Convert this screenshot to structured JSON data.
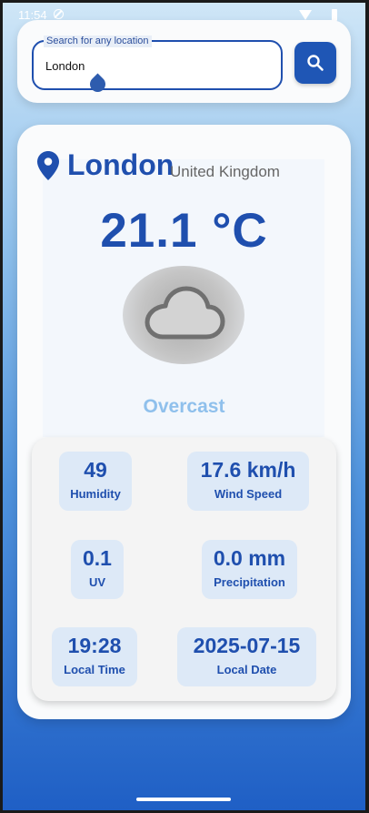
{
  "status_bar": {
    "time": "11:54"
  },
  "search": {
    "label": "Search for any location",
    "value": "London"
  },
  "weather": {
    "city": "London",
    "country": "United Kingdom",
    "temperature": "21.1 °C",
    "condition": "Overcast",
    "icon": "cloud-icon"
  },
  "stats": {
    "humidity": {
      "value": "49",
      "label": "Humidity"
    },
    "wind": {
      "value": "17.6 km/h",
      "label": "Wind Speed"
    },
    "uv": {
      "value": "0.1",
      "label": "UV"
    },
    "precipitation": {
      "value": "0.0 mm",
      "label": "Precipitation"
    },
    "local_time": {
      "value": "19:28",
      "label": "Local Time"
    },
    "local_date": {
      "value": "2025-07-15",
      "label": "Local Date"
    }
  },
  "colors": {
    "primary": "#1f4fae",
    "condition": "#8fc0ec",
    "stat_bg": "#dde9f7"
  }
}
